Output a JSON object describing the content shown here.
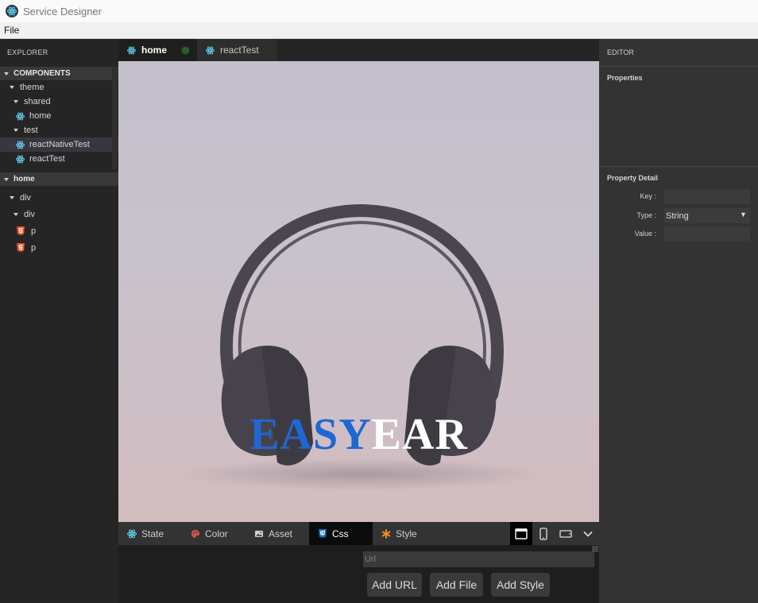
{
  "window": {
    "title": "Service Designer"
  },
  "menu": {
    "file": "File"
  },
  "explorer": {
    "title": "EXPLORER",
    "components_header": "COMPONENTS",
    "tree": {
      "theme": "theme",
      "shared": "shared",
      "home": "home",
      "test": "test",
      "reactNativeTest": "reactNativeTest",
      "reactTest": "reactTest"
    },
    "home_header": "home",
    "dom": {
      "div1": "div",
      "div2": "div",
      "p1": "p",
      "p2": "p"
    }
  },
  "tabs": [
    {
      "label": "home"
    },
    {
      "label": "reactTest"
    }
  ],
  "preview": {
    "logo_part1": "EASY",
    "logo_part2": "EAR"
  },
  "bottom_tabs": [
    {
      "label": "State"
    },
    {
      "label": "Color"
    },
    {
      "label": "Asset"
    },
    {
      "label": "Css"
    },
    {
      "label": "Style"
    }
  ],
  "css_panel": {
    "url_placeholder": "Url",
    "add_url": "Add URL",
    "add_file": "Add File",
    "add_style": "Add Style"
  },
  "editor": {
    "title": "EDITOR",
    "properties": "Properties",
    "property_detail": "Property Detail",
    "key_label": "Key :",
    "type_label": "Type :",
    "type_value": "String",
    "value_label": "Value :"
  },
  "colors": {
    "accent_blue": "#1f67d2",
    "react": "#61dafb",
    "html5": "#e44d26",
    "modified_dot": "#2f5b32"
  }
}
